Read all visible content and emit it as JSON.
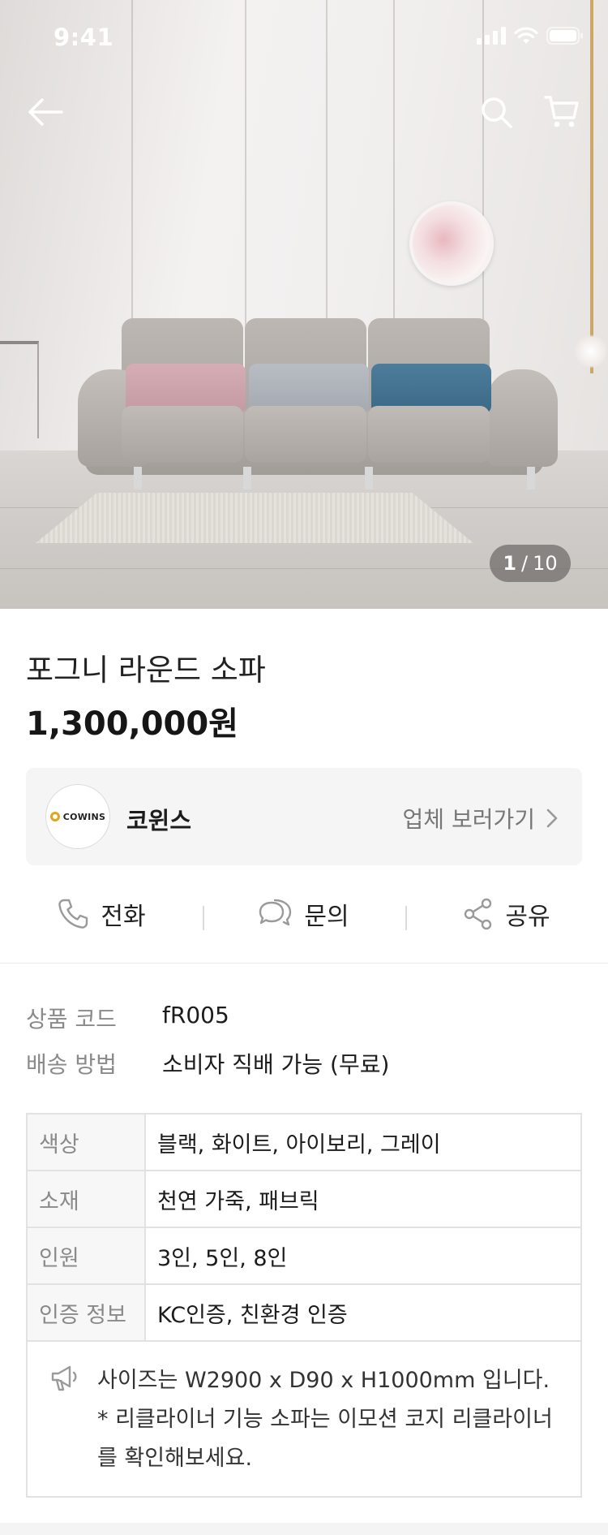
{
  "status_bar": {
    "time": "9:41"
  },
  "hero": {
    "image_alt": "Gray three-seat sofa with pink, gray and blue cushions in a bright living room",
    "counter_current": "1",
    "counter_total": "10"
  },
  "product": {
    "title": "포그니 라운드 소파",
    "price": "1,300,000원"
  },
  "brand": {
    "logo_text": "COWINS",
    "name": "코윈스",
    "link_label": "업체 보러가기"
  },
  "actions": [
    {
      "label": "전화",
      "icon": "phone-icon"
    },
    {
      "label": "문의",
      "icon": "chat-icon"
    },
    {
      "label": "공유",
      "icon": "share-icon"
    }
  ],
  "specs": [
    {
      "key": "상품 코드",
      "value": "fR005"
    },
    {
      "key": "배송 방법",
      "value": "소비자 직배 가능 (무료)"
    }
  ],
  "table": [
    {
      "key": "색상",
      "value": "블랙, 화이트, 아이보리, 그레이"
    },
    {
      "key": "소재",
      "value": "천연 가죽, 패브릭"
    },
    {
      "key": "인원",
      "value": "3인, 5인, 8인"
    },
    {
      "key": "인증 정보",
      "value": "KC인증, 친환경 인증"
    }
  ],
  "note": {
    "icon": "megaphone-icon",
    "lines": [
      "사이즈는 W2900 x D90 x H1000mm 입니다.",
      "* 리클라이너 기능 소파는 이모션 코지 리클라이너",
      "를 확인해보세요."
    ]
  },
  "colors": {
    "text_primary": "#1c1c1c",
    "text_secondary": "#8a8a8a",
    "card_bg": "#f5f5f5",
    "border": "#e2e2e2",
    "logo_accent": "#e3a51d"
  }
}
